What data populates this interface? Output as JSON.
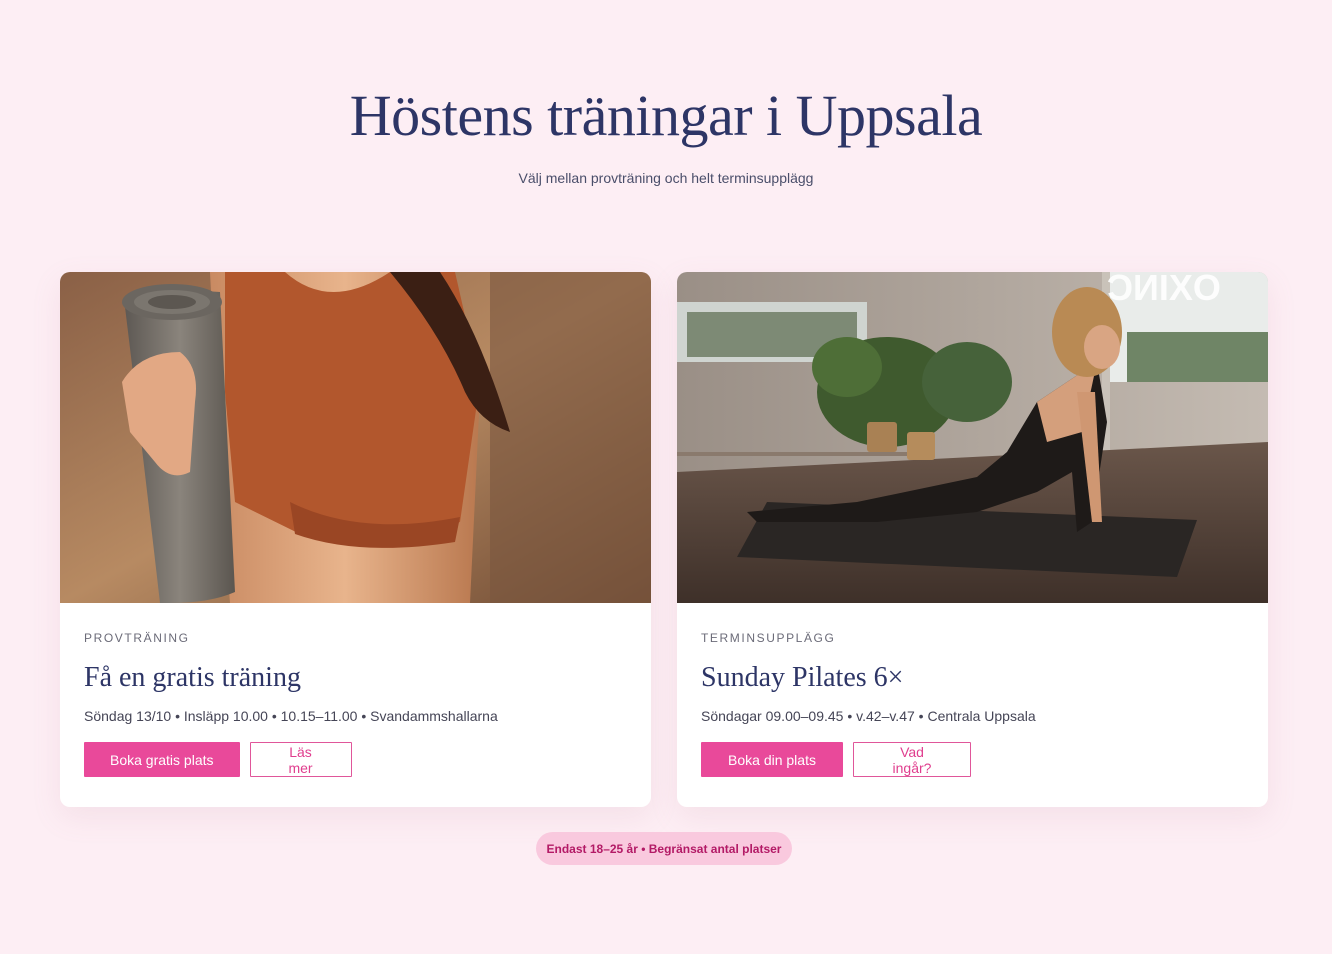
{
  "hero": {
    "title": "Höstens träningar i Uppsala",
    "subtitle": "Välj mellan provträning och helt terminsupplägg"
  },
  "cards": [
    {
      "eyebrow": "PROVTRÄNING",
      "title": "Få en gratis träning",
      "meta": "Söndag 13/10 • Insläpp 10.00 • 10.15–11.00 • Svandammshallarna",
      "primary_button": "Boka gratis plats",
      "secondary_button": "Läs mer"
    },
    {
      "eyebrow": "TERMINSUPPLÄGG",
      "title": "Sunday Pilates 6×",
      "meta": "Söndagar 09.00–09.45 • v.42–v.47 • Centrala Uppsala",
      "primary_button": "Boka din plats",
      "secondary_button": "Vad ingår?"
    }
  ],
  "badge": "Endast 18–25 år • Begränsat antal platser",
  "colors": {
    "background": "#fdeef4",
    "heading": "#2d3566",
    "accent": "#e9499a",
    "badge_bg": "#f9c9de",
    "badge_text": "#b31a66"
  }
}
